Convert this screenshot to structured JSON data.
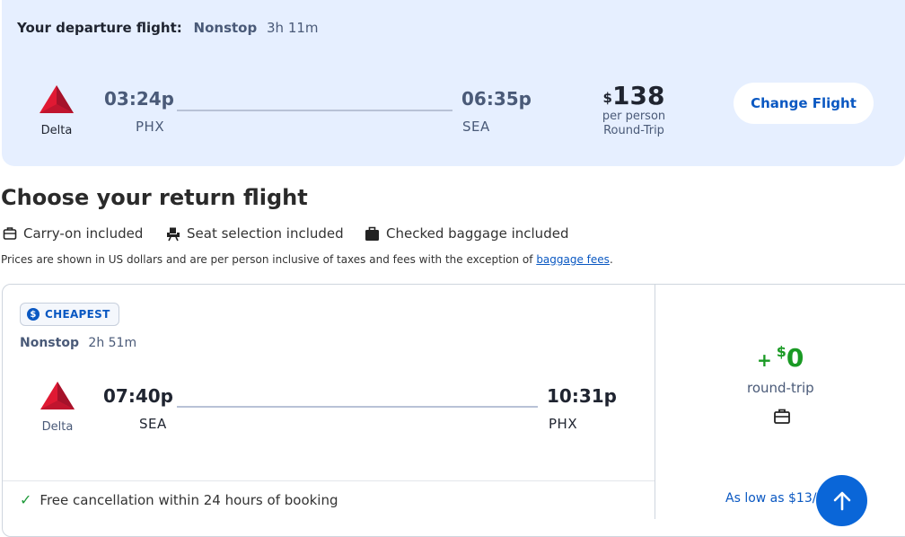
{
  "departure": {
    "label": "Your departure flight:",
    "stops": "Nonstop",
    "duration": "3h 11m",
    "airline": "Delta",
    "depart_time": "03:24p",
    "depart_code": "PHX",
    "arrive_time": "06:35p",
    "arrive_code": "SEA",
    "price_currency": "$",
    "price_value": "138",
    "price_note": "per person",
    "price_type": "Round-Trip",
    "change_button": "Change Flight"
  },
  "return_section": {
    "title": "Choose your return flight",
    "amenities": [
      {
        "label": "Carry-on included",
        "icon": "carry-on-icon"
      },
      {
        "label": "Seat selection included",
        "icon": "seat-icon"
      },
      {
        "label": "Checked baggage included",
        "icon": "checked-bag-icon"
      }
    ],
    "note_text": "Prices are shown in US dollars and are per person inclusive of taxes and fees with the exception of ",
    "note_link": "baggage fees",
    "note_end": "."
  },
  "return_card": {
    "badge": "CHEAPEST",
    "badge_icon": "dollar-coin-icon",
    "stops": "Nonstop",
    "duration": "2h 51m",
    "airline": "Delta",
    "depart_time": "07:40p",
    "depart_code": "SEA",
    "arrive_time": "10:31p",
    "arrive_code": "PHX",
    "cancellation": "Free cancellation within 24 hours of booking",
    "add_sign": "+",
    "add_currency": "$",
    "add_value": "0",
    "add_type": "round-trip",
    "as_low_as": "As low as $13/"
  },
  "colors": {
    "accent": "#0a58c2",
    "departure_bg": "#e6efff",
    "delta_red": "#e01933",
    "price_green": "#1a9a24",
    "fab": "#0a66d8"
  }
}
